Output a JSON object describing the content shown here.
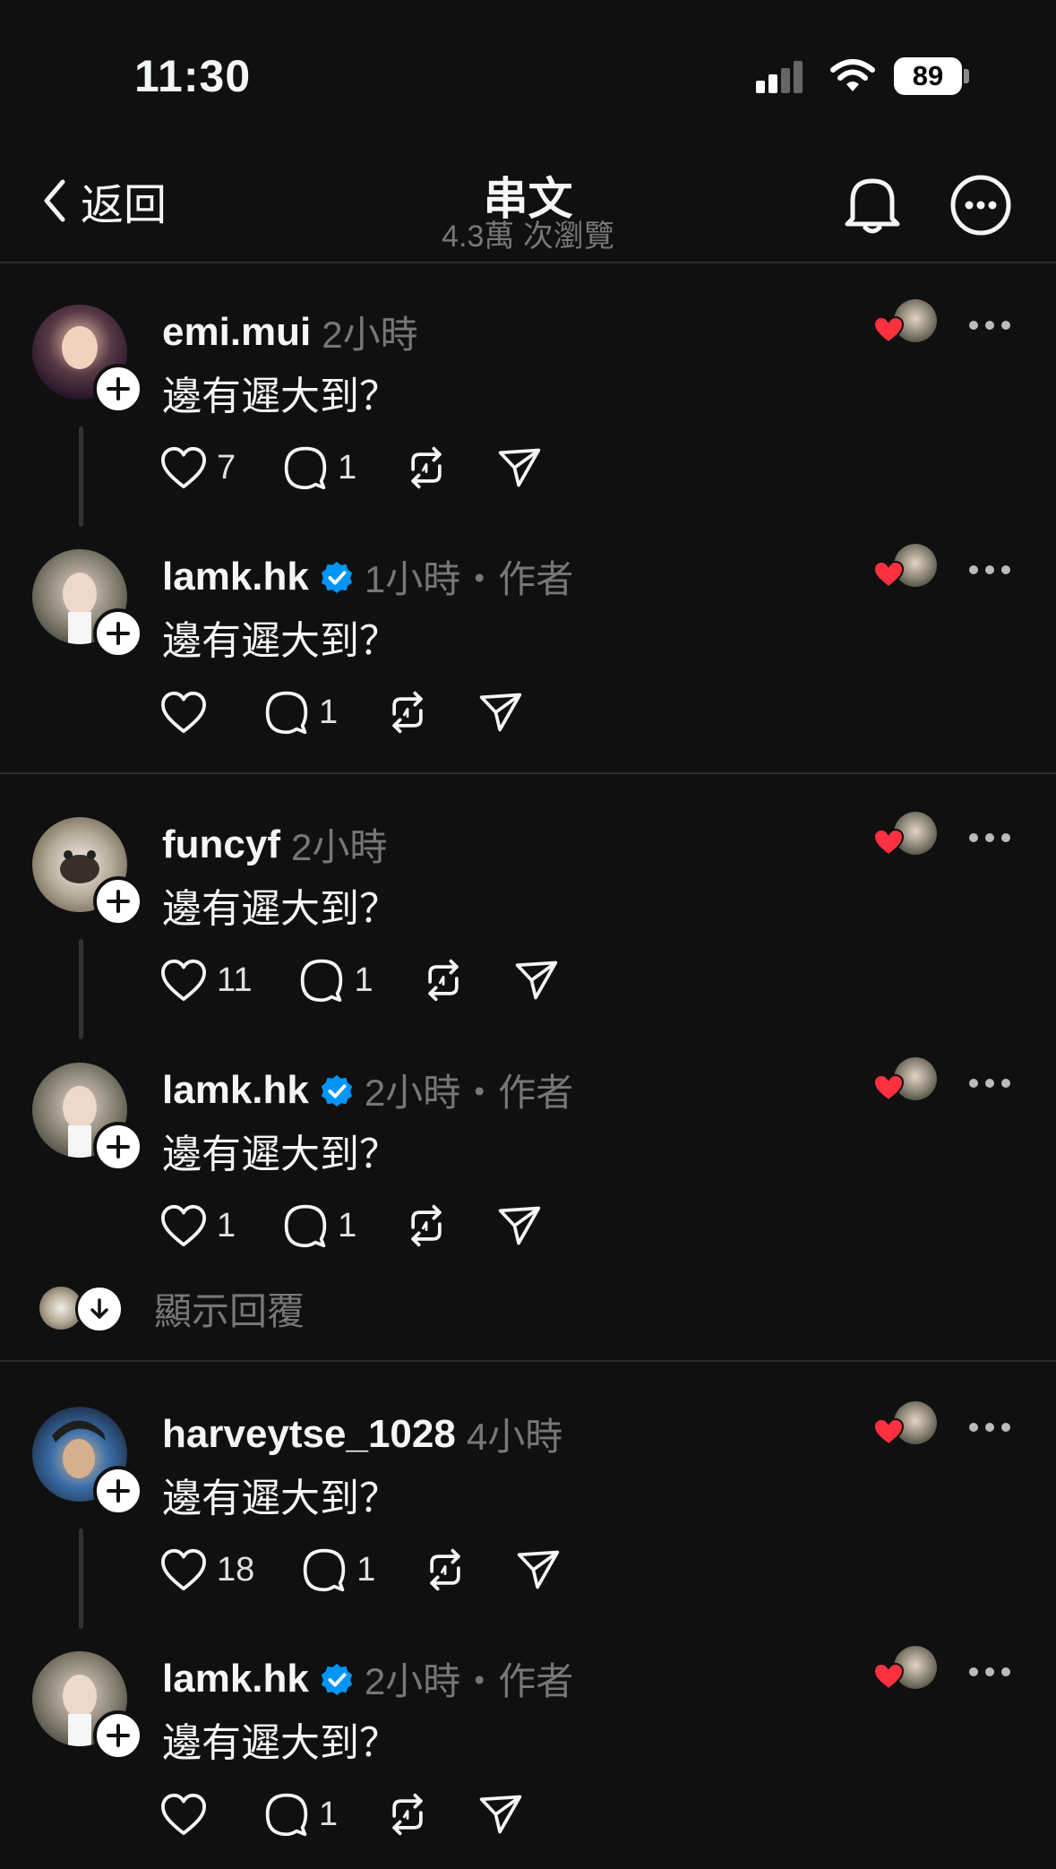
{
  "status_bar": {
    "time": "11:30",
    "battery": "89"
  },
  "header": {
    "back_label": "返回",
    "title": "串文",
    "views": "4.3萬 次瀏覽"
  },
  "replies": [
    {
      "username": "emi.mui",
      "meta": "2小時",
      "text": "邊有遲大到？",
      "likes": "7",
      "comments": "1",
      "verified": false
    },
    {
      "username": "lamk.hk",
      "meta": "1小時・作者",
      "text": "邊有遲大到？",
      "likes": "",
      "comments": "1",
      "verified": true
    },
    {
      "username": "funcyf",
      "meta": "2小時",
      "text": "邊有遲大到？",
      "likes": "11",
      "comments": "1",
      "verified": false
    },
    {
      "username": "lamk.hk",
      "meta": "2小時・作者",
      "text": "邊有遲大到？",
      "likes": "1",
      "comments": "1",
      "verified": true
    },
    {
      "username": "harveytse_1028",
      "meta": "4小時",
      "text": "邊有遲大到？",
      "likes": "18",
      "comments": "1",
      "verified": false
    },
    {
      "username": "lamk.hk",
      "meta": "2小時・作者",
      "text": "邊有遲大到？",
      "likes": "",
      "comments": "1",
      "verified": true
    }
  ],
  "show_replies_label": "顯示回覆",
  "colors": {
    "background": "#101010",
    "verified": "#0095f6",
    "heart": "#ff3040",
    "muted": "#777777"
  },
  "icons": [
    "back-chevron-icon",
    "bell-icon",
    "more-circle-icon",
    "heart-icon",
    "comment-icon",
    "repost-icon",
    "share-icon",
    "verified-icon",
    "more-icon"
  ]
}
